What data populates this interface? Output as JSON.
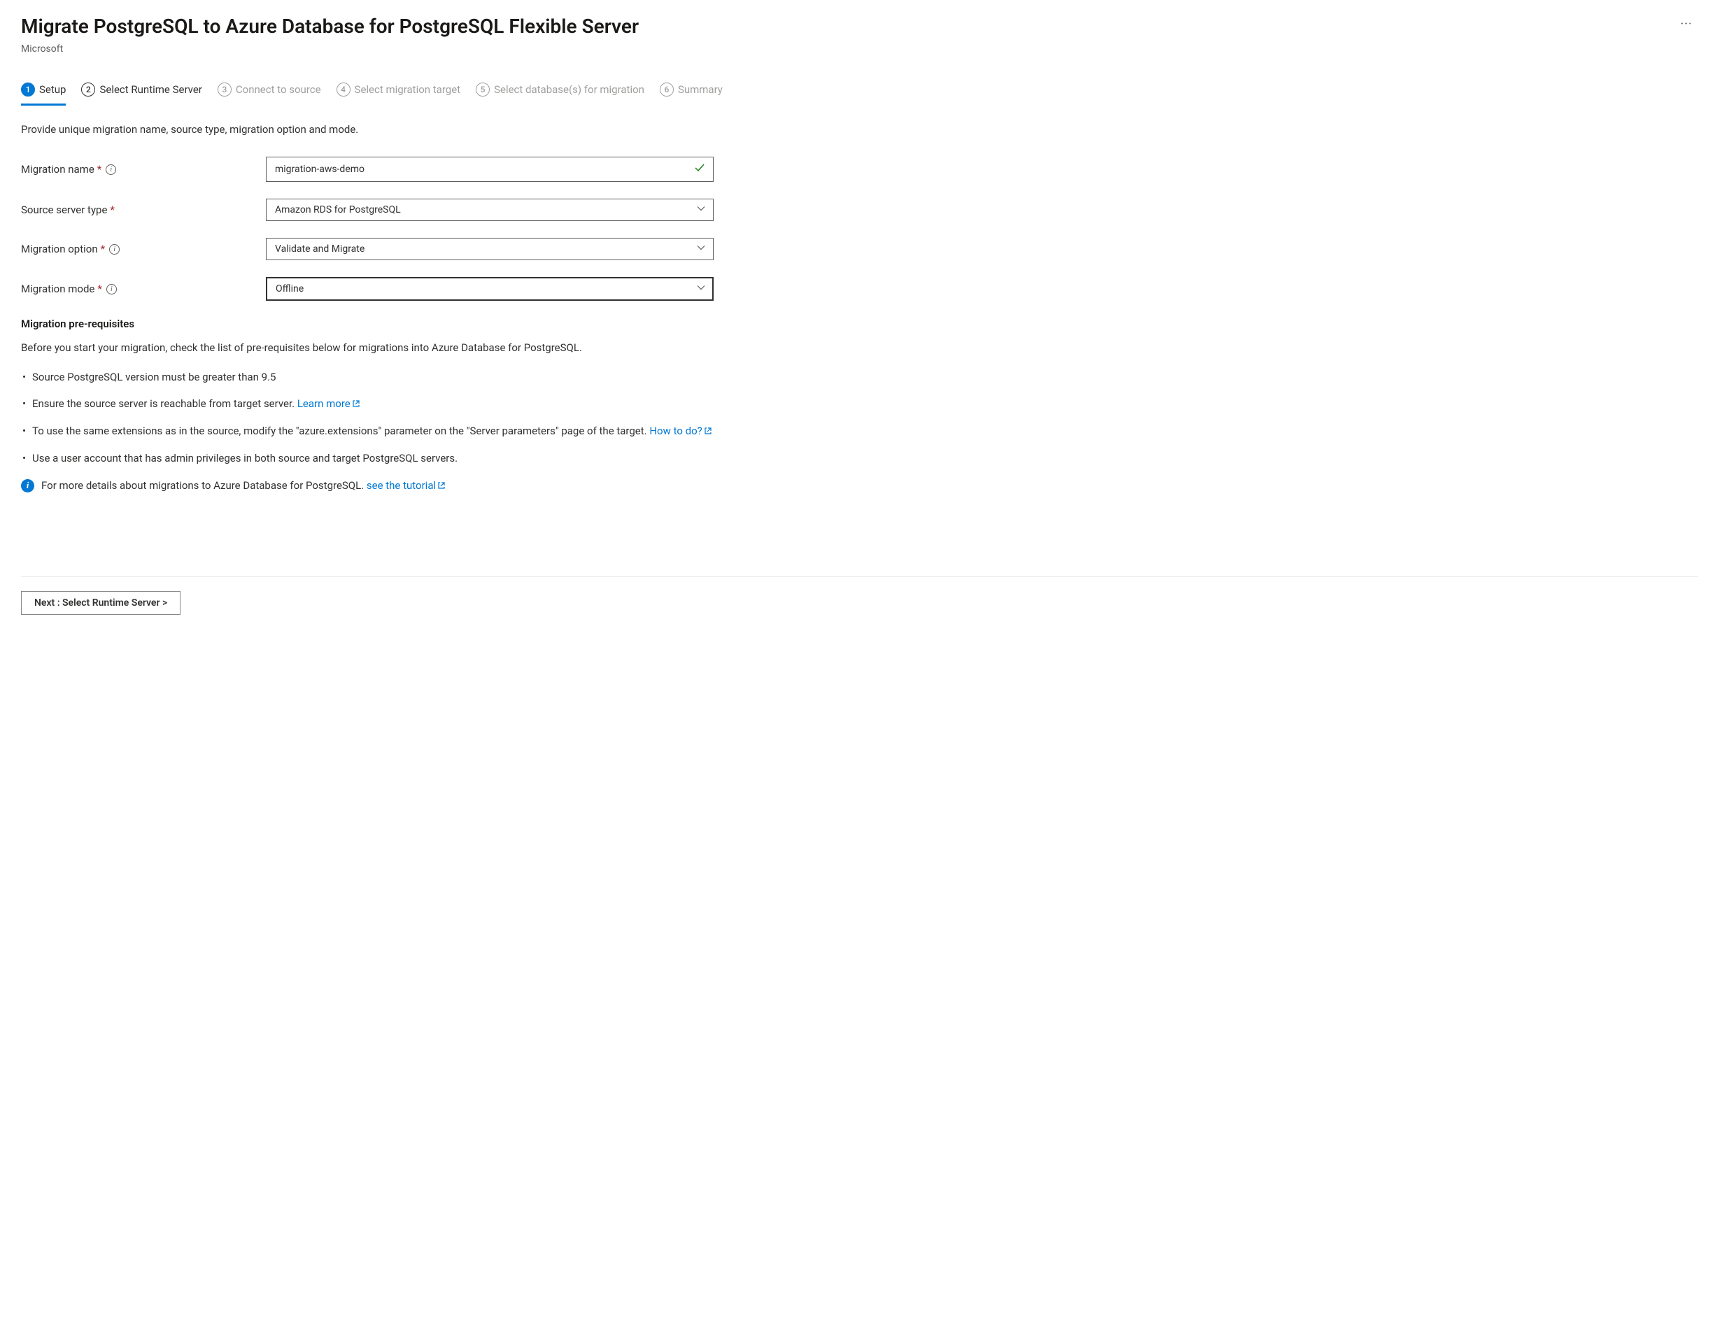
{
  "header": {
    "title": "Migrate PostgreSQL to Azure Database for PostgreSQL Flexible Server",
    "subtitle": "Microsoft"
  },
  "tabs": [
    {
      "num": "1",
      "label": "Setup",
      "state": "active"
    },
    {
      "num": "2",
      "label": "Select Runtime Server",
      "state": "enabled"
    },
    {
      "num": "3",
      "label": "Connect to source",
      "state": "disabled"
    },
    {
      "num": "4",
      "label": "Select migration target",
      "state": "disabled"
    },
    {
      "num": "5",
      "label": "Select database(s) for migration",
      "state": "disabled"
    },
    {
      "num": "6",
      "label": "Summary",
      "state": "disabled"
    }
  ],
  "instruction": "Provide unique migration name, source type, migration option and mode.",
  "form": {
    "migration_name": {
      "label": "Migration name",
      "value": "migration-aws-demo"
    },
    "source_server_type": {
      "label": "Source server type",
      "value": "Amazon RDS for PostgreSQL"
    },
    "migration_option": {
      "label": "Migration option",
      "value": "Validate and Migrate"
    },
    "migration_mode": {
      "label": "Migration mode",
      "value": "Offline"
    }
  },
  "prereq": {
    "title": "Migration pre-requisites",
    "intro": "Before you start your migration, check the list of pre-requisites below for migrations into Azure Database for PostgreSQL.",
    "items": {
      "i1": "Source PostgreSQL version must be greater than 9.5",
      "i2a": "Ensure the source server is reachable from target server. ",
      "i2_link": "Learn more",
      "i3a": "To use the same extensions as in the source, modify the \"azure.extensions\" parameter on the \"Server parameters\" page of the target. ",
      "i3_link": "How to do?",
      "i4": "Use a user account that has admin privileges in both source and target PostgreSQL servers."
    },
    "note_text": "For more details about migrations to Azure Database for PostgreSQL. ",
    "note_link": "see the tutorial"
  },
  "footer": {
    "next_label": "Next : Select Runtime Server >"
  }
}
